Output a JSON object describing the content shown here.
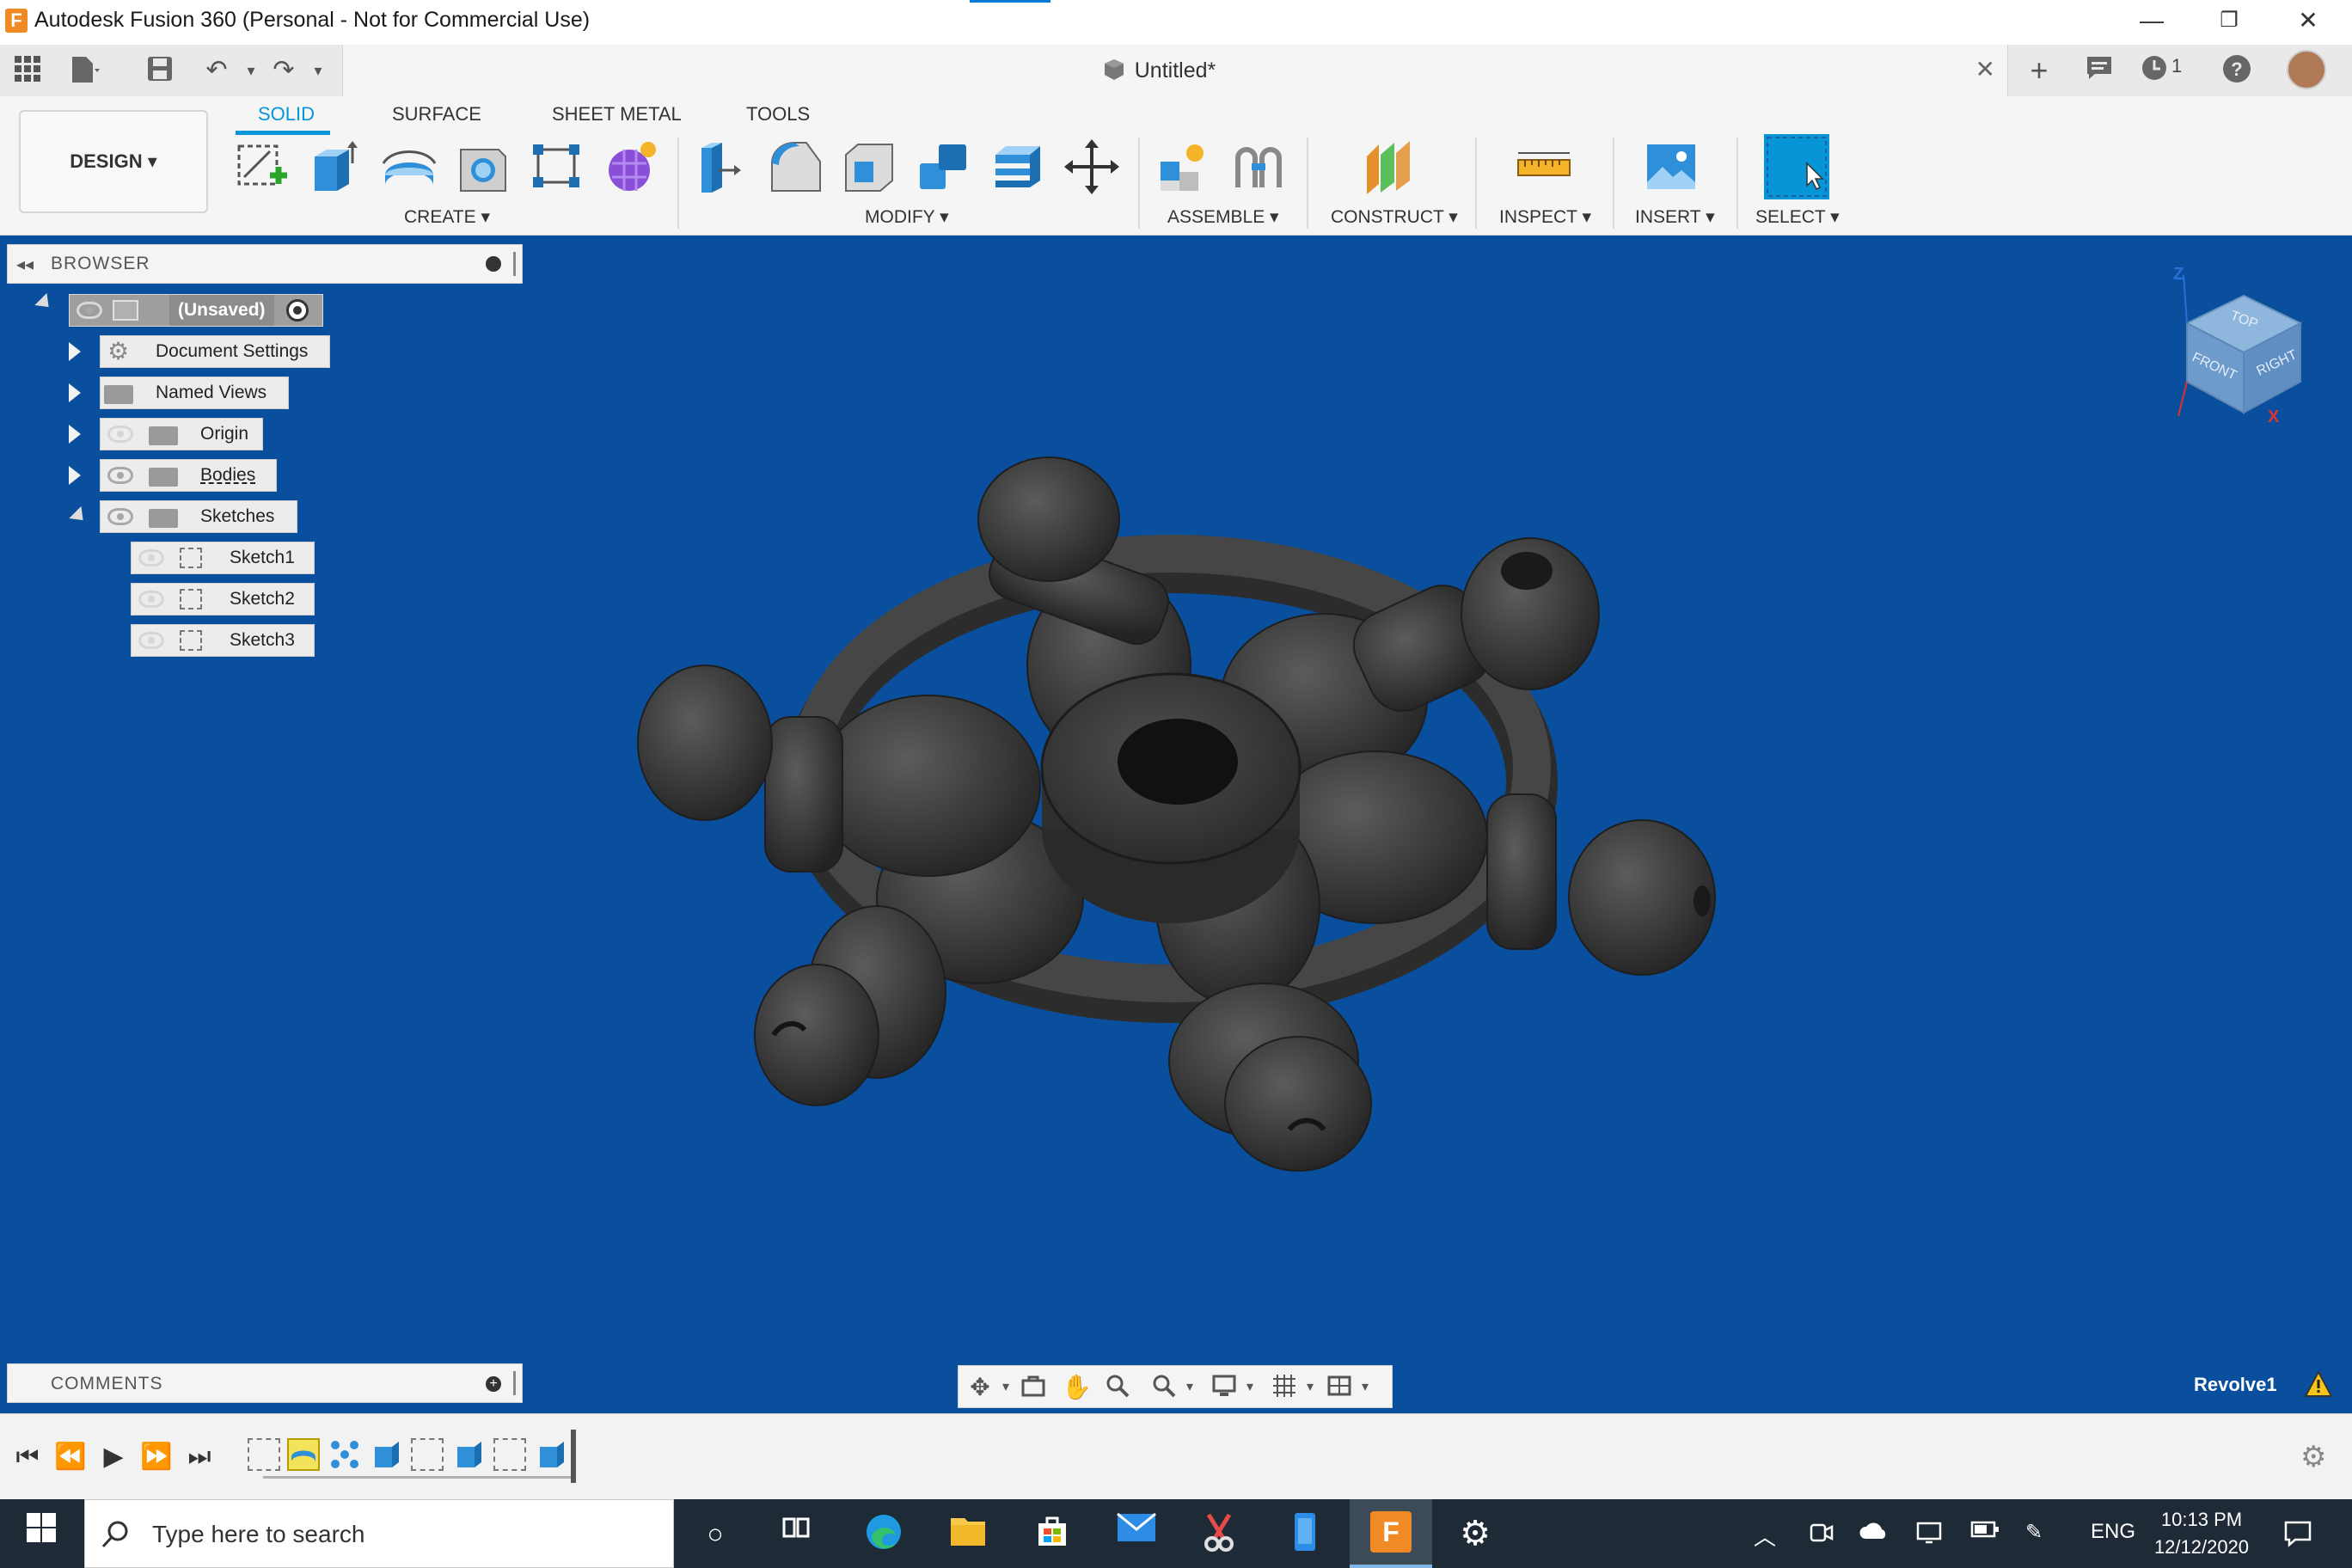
{
  "window": {
    "title": "Autodesk Fusion 360 (Personal - Not for Commercial Use)",
    "logo_letter": "F",
    "minimize": "—",
    "restore": "❐",
    "close": "✕"
  },
  "quickbar": {
    "doc_title": "Untitled*",
    "job_count": "1"
  },
  "ribbon": {
    "workspace": "DESIGN ▾",
    "tabs": [
      "SOLID",
      "SURFACE",
      "SHEET METAL",
      "TOOLS"
    ],
    "groups": [
      "CREATE ▾",
      "MODIFY ▾",
      "ASSEMBLE ▾",
      "CONSTRUCT ▾",
      "INSPECT ▾",
      "INSERT ▾",
      "SELECT ▾"
    ]
  },
  "browser": {
    "title": "BROWSER",
    "root": "(Unsaved)",
    "nodes": [
      "Document Settings",
      "Named Views",
      "Origin",
      "Bodies",
      "Sketches"
    ],
    "sketches": [
      "Sketch1",
      "Sketch2",
      "Sketch3"
    ]
  },
  "viewcube": {
    "top": "TOP",
    "front": "FRONT",
    "right": "RIGHT",
    "axis_z": "Z",
    "axis_x": "X"
  },
  "comments": {
    "title": "COMMENTS"
  },
  "status": {
    "feature_name": "Revolve1"
  },
  "taskbar": {
    "search_placeholder": "Type here to search",
    "lang": "ENG",
    "time": "10:13 PM",
    "date": "12/12/2020"
  },
  "colors": {
    "viewport_bg": "#0a4f9e",
    "accent": "#0696d7",
    "model": "#3a3a3a",
    "taskbar": "#1e2a36"
  }
}
